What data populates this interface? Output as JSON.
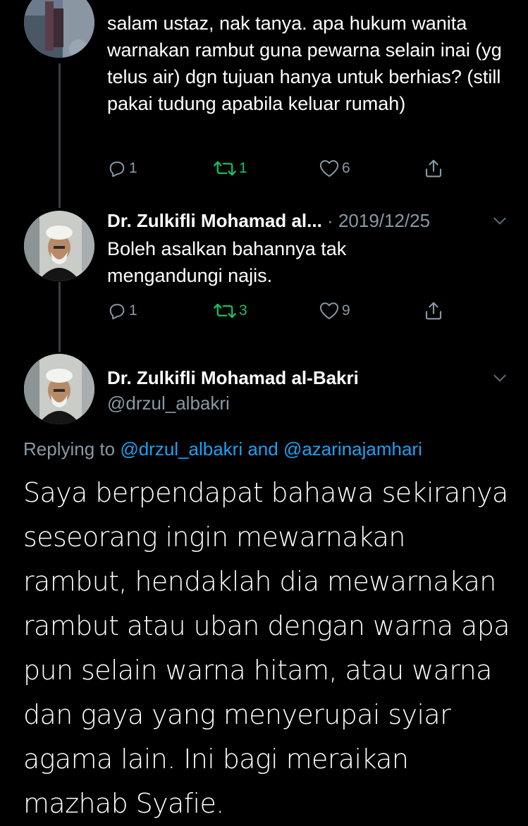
{
  "colors": {
    "background": "#000000",
    "text_primary": "#ffffff",
    "text_secondary": "#8899a6",
    "retweet_active": "#17bf63",
    "link": "#1da1f2",
    "thread_line": "#3a3d41"
  },
  "tweet1": {
    "text": "salam ustaz, nak tanya. apa hukum wanita warnakan rambut guna pewarna selain inai (yg telus air) dgn tujuan hanya untuk berhias? (still pakai tudung apabila keluar rumah)",
    "reply_count": "1",
    "retweet_count": "1",
    "like_count": "6"
  },
  "tweet2": {
    "author_name": "Dr. Zulkifli Mohamad al...",
    "separator": " · ",
    "date": "2019/12/25",
    "text": "Boleh asalkan bahannya tak mengandungi najis.",
    "reply_count": "1",
    "retweet_count": "3",
    "like_count": "9"
  },
  "main_tweet": {
    "author_name": "Dr. Zulkifli Mohamad al-Bakri",
    "handle": "@drzul_albakri",
    "replying_prefix": "Replying to ",
    "replying_mention_1": "@drzul_albakri",
    "replying_and": " and ",
    "replying_mention_2": "@azarinajamhari",
    "text": "Saya berpendapat bahawa sekiranya seseorang ingin mewarnakan rambut, hendaklah dia mewarnakan rambut atau uban dengan warna apa pun selain warna hitam, atau warna dan gaya yang menyerupai syiar agama lain. Ini bagi meraikan mazhab Syafie."
  },
  "icons": {
    "reply": "reply-icon",
    "retweet": "retweet-icon",
    "like": "heart-icon",
    "share": "share-icon",
    "more": "chevron-down-icon"
  }
}
